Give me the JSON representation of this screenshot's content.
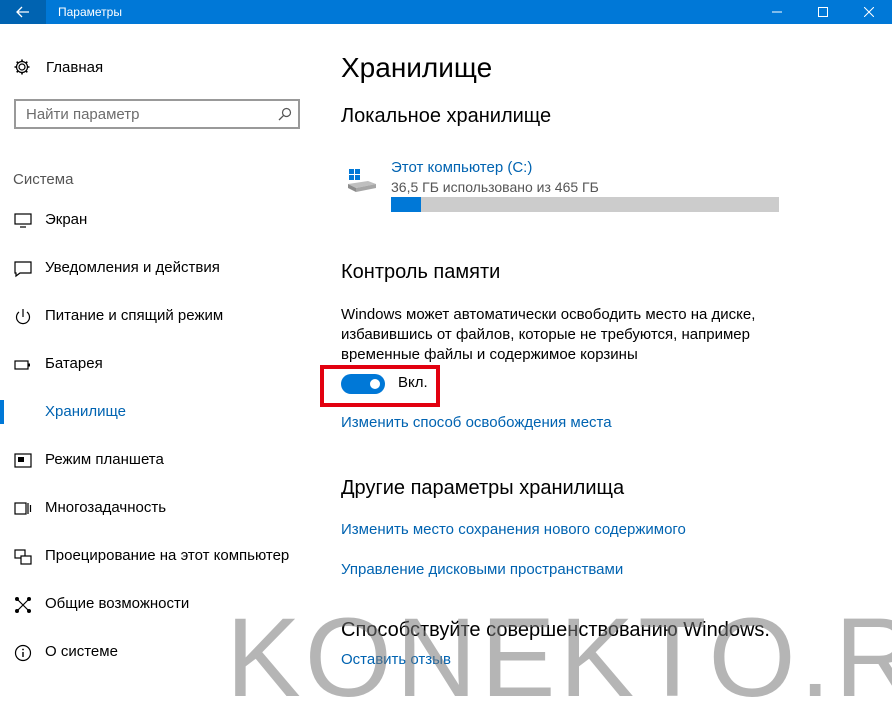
{
  "window": {
    "title": "Параметры",
    "controls": [
      "minimize-icon",
      "maximize-icon",
      "close-icon"
    ]
  },
  "sidebar": {
    "home_label": "Главная",
    "search_placeholder": "Найти параметр",
    "section_title": "Система",
    "items": [
      {
        "label": "Экран",
        "icon": "display-icon"
      },
      {
        "label": "Уведомления и действия",
        "icon": "notifications-icon"
      },
      {
        "label": "Питание и спящий режим",
        "icon": "power-icon"
      },
      {
        "label": "Батарея",
        "icon": "battery-icon"
      },
      {
        "label": "Хранилище",
        "icon": "storage-icon",
        "active": true
      },
      {
        "label": "Режим планшета",
        "icon": "tablet-mode-icon"
      },
      {
        "label": "Многозадачность",
        "icon": "multitasking-icon"
      },
      {
        "label": "Проецирование на этот компьютер",
        "icon": "projecting-icon"
      },
      {
        "label": "Общие возможности",
        "icon": "shared-experiences-icon"
      },
      {
        "label": "О системе",
        "icon": "about-icon"
      }
    ]
  },
  "main": {
    "title": "Хранилище",
    "local_storage_heading": "Локальное хранилище",
    "drive": {
      "name": "Этот компьютер (C:)",
      "usage": "36,5 ГБ использовано из 465 ГБ",
      "used_fraction": 0.0785
    },
    "storage_sense": {
      "heading": "Контроль памяти",
      "description": "Windows может автоматически освободить место на диске, избавившись от файлов, которые не требуются, например временные файлы и содержимое корзины",
      "toggle_state": "Вкл.",
      "change_link": "Изменить способ освобождения места"
    },
    "other_settings": {
      "heading": "Другие параметры хранилища",
      "links": [
        "Изменить место сохранения нового содержимого",
        "Управление дисковыми пространствами"
      ]
    },
    "feedback": {
      "heading": "Способствуйте совершенствованию Windows.",
      "link": "Оставить отзыв"
    }
  },
  "watermark": "KONEKTO.RU",
  "colors": {
    "accent": "#0078d7",
    "link": "#0063b1",
    "highlight": "#e2000f"
  }
}
